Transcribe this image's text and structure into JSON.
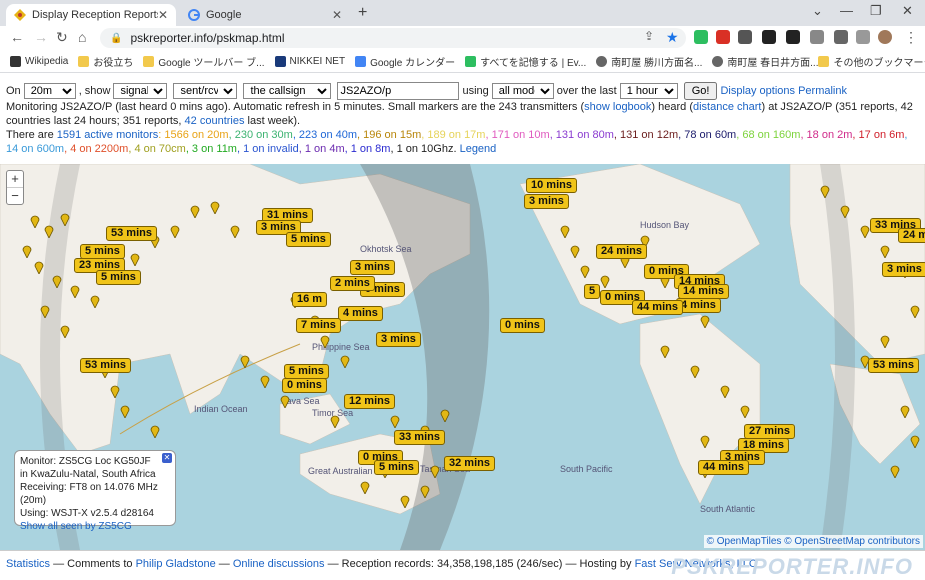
{
  "browser": {
    "tabs": [
      {
        "label": "Display Reception Reports"
      },
      {
        "label": "Google"
      }
    ],
    "url": "pskreporter.info/pskmap.html",
    "bookmarks": [
      "Wikipedia",
      "お役立ち",
      "Google ツールバー ブ...",
      "NIKKEI NET",
      "Google カレンダー",
      "すべてを記憶する | Ev...",
      "南町屋 勝川方面名...",
      "南町屋 春日井方面...",
      "その他のブックマーク"
    ]
  },
  "controls": {
    "on_label": "On",
    "band": "20m",
    "show_label": ", show",
    "show_value": "signals",
    "direction": "sent/rcvd by",
    "target": "the callsign",
    "callsign": "JS2AZO/p",
    "using_label": "using",
    "mode": "all modes",
    "over_label": "over the last",
    "period": "1 hour",
    "go_label": "Go!",
    "display_options": "Display options",
    "permalink": "Permalink"
  },
  "status": {
    "part1": "Monitoring JS2AZO/P (last heard 0 mins ago). Automatic refresh in 5 minutes. Small markers are the 243 transmitters (",
    "show_logbook": "show logbook",
    "part2": ") heard (",
    "distance_chart": "distance chart",
    "part3": ") at JS2AZO/P (351 reports, 42 countries last 24 hours; 351 reports, ",
    "countries_link": "42 countries",
    "part4": " last week)."
  },
  "monitors": {
    "prefix": "There are ",
    "active": "1591 active monitors",
    "bands": [
      {
        "text": "1566 on 20m",
        "color": "#e8a317"
      },
      {
        "text": "230 on 30m",
        "color": "#3cb371"
      },
      {
        "text": "223 on 40m",
        "color": "#1e66d6"
      },
      {
        "text": "196 on 15m",
        "color": "#b8860b"
      },
      {
        "text": "189 on 17m",
        "color": "#e6d35a"
      },
      {
        "text": "171 on 10m",
        "color": "#e05bbf"
      },
      {
        "text": "131 on 80m",
        "color": "#8a3bd0"
      },
      {
        "text": "131 on 12m",
        "color": "#6b1d1d"
      },
      {
        "text": "78 on 60m",
        "color": "#1b1b6b"
      },
      {
        "text": "68 on 160m",
        "color": "#7dd33c"
      },
      {
        "text": "18 on 2m",
        "color": "#d02b8a"
      },
      {
        "text": "17 on 6m",
        "color": "#d0202b"
      },
      {
        "text": "14 on 600m",
        "color": "#3a9ad9"
      },
      {
        "text": "4 on 2200m",
        "color": "#e0502b"
      },
      {
        "text": "4 on 70cm",
        "color": "#a0a020"
      },
      {
        "text": "3 on 11m",
        "color": "#22aa22"
      },
      {
        "text": "1 on invalid",
        "color": "#2b55d0"
      },
      {
        "text": "1 on 4m",
        "color": "#6b2bb0"
      },
      {
        "text": "1 on 8m",
        "color": "#2b2bd0"
      },
      {
        "text": "1 on 10Ghz.",
        "color": "#222222"
      }
    ],
    "legend": "Legend"
  },
  "map": {
    "labels": [
      "10 mins",
      "3 mins",
      "31 mins",
      "3 mins",
      "53 mins",
      "5 mins",
      "5 mins",
      "23 mins",
      "5 mins",
      "3 mins",
      "0 mins",
      "2 mins",
      "16 m",
      "4 mins",
      "7 mins",
      "3 mins",
      "53 mins",
      "5 mins",
      "0 mins",
      "12 mins",
      "33 mins",
      "0 mins",
      "32 mins",
      "5 mins",
      "24 mins",
      "0 mins",
      "5",
      "0 mins",
      "14 mins",
      "14 mins",
      "4 mins",
      "44 mins",
      "0 mins",
      "27 mins",
      "18 mins",
      "3 mins",
      "44 mins",
      "53 mins",
      "33 mins",
      "24 mins",
      "3 mins"
    ],
    "places": [
      "Okhotsk Sea",
      "Hudson Bay",
      "Philippine Sea",
      "Java Sea",
      "Timor Sea",
      "Indian Ocean",
      "Great Australian Bight",
      "Tasman Sea",
      "South Pacific",
      "South Atlantic"
    ],
    "popup": {
      "monitor": "Monitor: ZS5CG Loc KG50JF",
      "location": "in KwaZulu-Natal, South Africa",
      "receiving": "Receiving: FT8 on 14.076 MHz (20m)",
      "using": "Using: WSJT-X v2.5.4 d28164",
      "show_all": "Show all seen by ZS5CG"
    },
    "attribution": {
      "tiles": "© OpenMapTiles",
      "osm": "© OpenStreetMap contributors"
    },
    "zoom_in": "+",
    "zoom_out": "−"
  },
  "footer": {
    "statistics": "Statistics",
    "comments": " — Comments to ",
    "gladstone": "Philip Gladstone",
    "sep": " — ",
    "discussions": "Online discussions",
    "records": " — Reception records: 34,358,198,185 (246/sec) — Hosting by ",
    "hosting": "Fast Serv Networks, LLC",
    "brand": "PSKREPORTER.INFO"
  }
}
